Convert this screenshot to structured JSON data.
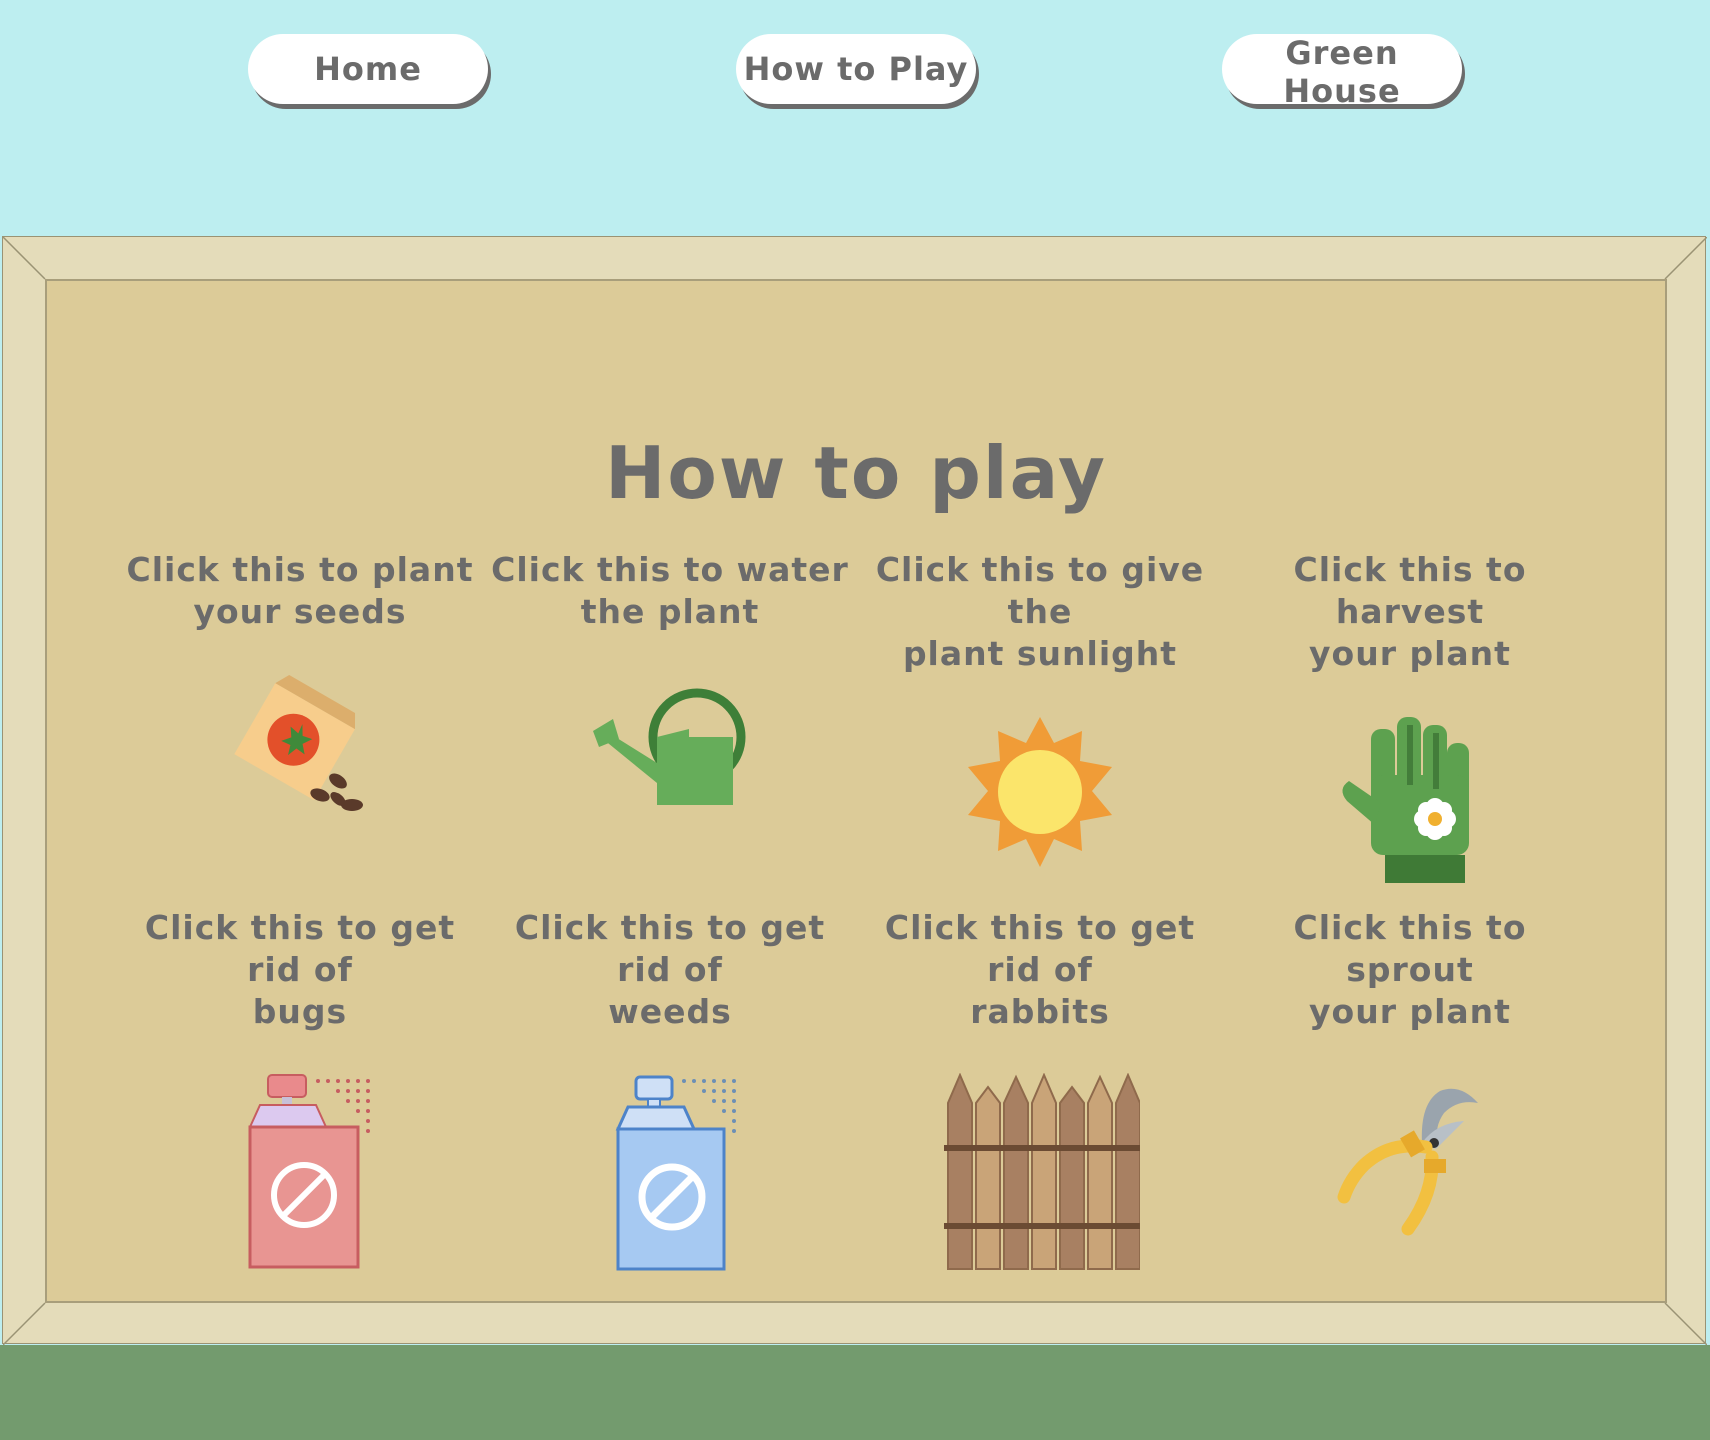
{
  "nav": {
    "home": "Home",
    "how_to_play": "How to Play",
    "green_house": "Green House"
  },
  "page": {
    "title": "How to play"
  },
  "instructions": [
    {
      "label": "Click this to plant\nyour seeds",
      "icon": "seed-packet-icon"
    },
    {
      "label": "Click this to water\nthe plant",
      "icon": "watering-can-icon"
    },
    {
      "label": "Click this to give the\nplant sunlight",
      "icon": "sun-icon"
    },
    {
      "label": "Click this to harvest\nyour plant",
      "icon": "gardening-glove-icon"
    },
    {
      "label": "Click this to get rid of\nbugs",
      "icon": "bug-spray-icon"
    },
    {
      "label": "Click this to get rid of\nweeds",
      "icon": "weed-spray-icon"
    },
    {
      "label": "Click this to get rid of\nrabbits",
      "icon": "fence-icon"
    },
    {
      "label": "Click this to sprout\nyour plant",
      "icon": "pruning-shears-icon"
    }
  ],
  "colors": {
    "sky": "#bdeef0",
    "frame": "#e4dcba",
    "board": "#dccb98",
    "grass": "#739b6e",
    "text": "#6b6b6b"
  }
}
